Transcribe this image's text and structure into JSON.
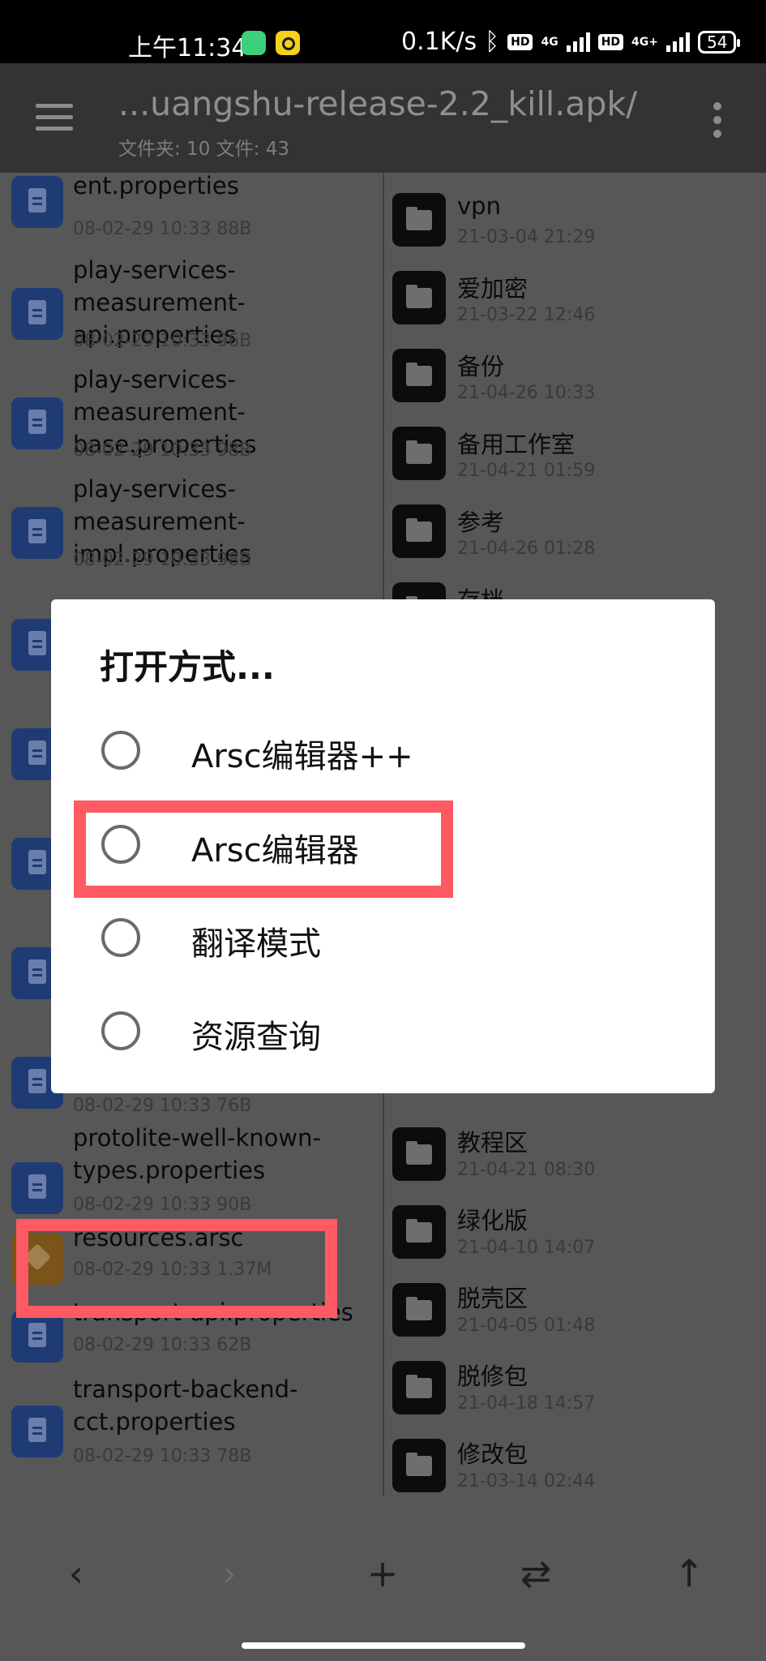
{
  "status_bar": {
    "time": "上午11:34",
    "speed": "0.1K/s",
    "network1": "4G",
    "network2": "4G+",
    "hd": "HD",
    "battery": "54"
  },
  "app_bar": {
    "title": "...uangshu-release-2.2_kill.apk/",
    "subtitle": "文件夹: 10   文件: 43"
  },
  "left_files": [
    {
      "name": "ent.properties",
      "meta": "08-02-29 10:33  88B",
      "icon": "document-icon"
    },
    {
      "name": "play-services-measurement-api.properties",
      "meta": "08-02-29 10:33  96B",
      "icon": "document-icon"
    },
    {
      "name": "play-services-measurement-base.properties",
      "meta": "08-02-29 10:33  98B",
      "icon": "document-icon"
    },
    {
      "name": "play-services-measurement-impl.properties",
      "meta": "08-02-29 10:33  98B",
      "icon": "document-icon"
    },
    {
      "name": "",
      "meta": "08-02-29 10:33  76B",
      "icon": "document-icon"
    },
    {
      "name": "protolite-well-known-types.properties",
      "meta": "08-02-29 10:33  90B",
      "icon": "document-icon"
    },
    {
      "name": "resources.arsc",
      "meta": "08-02-29 10:33  1.37M",
      "icon": "arsc-icon"
    },
    {
      "name": "transport-api.properties",
      "meta": "08-02-29 10:33  62B",
      "icon": "document-icon"
    },
    {
      "name": "transport-backend-cct.properties",
      "meta": "08-02-29 10:33  78B",
      "icon": "document-icon"
    }
  ],
  "right_folders": [
    {
      "name": "vpn",
      "meta": "21-03-04 21:29"
    },
    {
      "name": "爱加密",
      "meta": "21-03-22 12:46"
    },
    {
      "name": "备份",
      "meta": "21-04-26 10:33"
    },
    {
      "name": "备用工作室",
      "meta": "21-04-21 01:59"
    },
    {
      "name": "参考",
      "meta": "21-04-26 01:28"
    },
    {
      "name": "存档",
      "meta": ""
    },
    {
      "name": "教程区",
      "meta": "21-04-21 08:30"
    },
    {
      "name": "绿化版",
      "meta": "21-04-10 14:07"
    },
    {
      "name": "脱壳区",
      "meta": "21-04-05 01:48"
    },
    {
      "name": "脱修包",
      "meta": "21-04-18 14:57"
    },
    {
      "name": "修改包",
      "meta": "21-03-14 02:44"
    }
  ],
  "bottom_bar": {
    "back": "‹",
    "forward": "›",
    "add": "+",
    "swap": "⇄",
    "up": "↑"
  },
  "dialog": {
    "title": "打开方式...",
    "options": [
      {
        "label": "Arsc编辑器++"
      },
      {
        "label": "Arsc编辑器"
      },
      {
        "label": "翻译模式"
      },
      {
        "label": "资源查询"
      }
    ]
  },
  "colors": {
    "highlight": "#ff5a63",
    "file_icon": "#1f3b73",
    "arsc_icon": "#7a5418"
  }
}
